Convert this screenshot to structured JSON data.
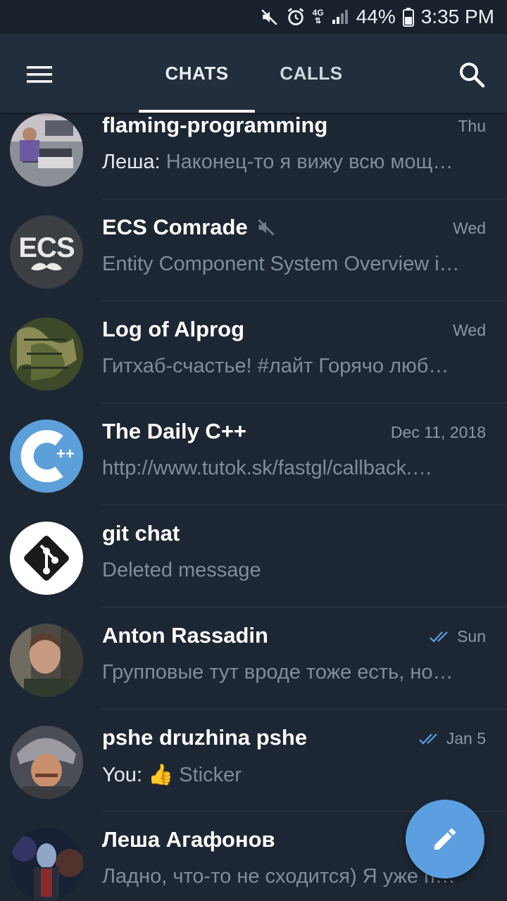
{
  "status_bar": {
    "battery": "44%",
    "time": "3:35 PM",
    "network": "4G",
    "icons": [
      "mute-icon",
      "alarm-icon",
      "network-4g-icon",
      "signal-icon",
      "battery-icon"
    ]
  },
  "header": {
    "tabs": [
      {
        "label": "CHATS",
        "active": true
      },
      {
        "label": "CALLS",
        "active": false
      }
    ],
    "icons": [
      "menu-icon",
      "search-icon"
    ]
  },
  "chats": [
    {
      "name": "flaming-programming",
      "date": "Thu",
      "sender": "Леша:",
      "preview": "Наконец-то я вижу всю мощ…",
      "avatar": "photo-group",
      "muted": false,
      "read": false
    },
    {
      "name": "ECS Comrade",
      "date": "Wed",
      "preview": "Entity Component System Overview i…",
      "avatar_text": "ECS",
      "muted": true,
      "read": false
    },
    {
      "name": "Log of Alprog",
      "date": "Wed",
      "preview": "Гитхаб-счастье! #лайт Горячо люб…",
      "avatar": "photo-map",
      "muted": false,
      "read": false
    },
    {
      "name": "The Daily C++",
      "date": "Dec 11, 2018",
      "preview": "http://www.tutok.sk/fastgl/callback.…",
      "avatar_text": "++",
      "muted": false,
      "read": false
    },
    {
      "name": "git chat",
      "date": "",
      "preview": "Deleted message",
      "avatar": "git-logo",
      "muted": false,
      "read": false
    },
    {
      "name": "Anton Rassadin",
      "date": "Sun",
      "preview": "Групповые тут вроде тоже есть, но…",
      "avatar": "photo-person",
      "muted": false,
      "read": true
    },
    {
      "name": "pshe druzhina pshe",
      "date": "Jan 5",
      "sender": "You:",
      "sticker_emoji": "👍",
      "preview": "Sticker",
      "avatar": "photo-person-hat",
      "muted": false,
      "read": true
    },
    {
      "name": "Леша Агафонов",
      "date": "",
      "preview": "Ладно, что-то не сходится)  Я уже п…",
      "avatar": "photo-space",
      "muted": false,
      "read": false
    }
  ],
  "fab": {
    "icon": "pencil-icon"
  },
  "colors": {
    "background": "#1d2733",
    "header": "#222e3b",
    "accent": "#5b9fe0",
    "read_check": "#5b9fe0",
    "secondary_text": "#7f8e9b"
  }
}
